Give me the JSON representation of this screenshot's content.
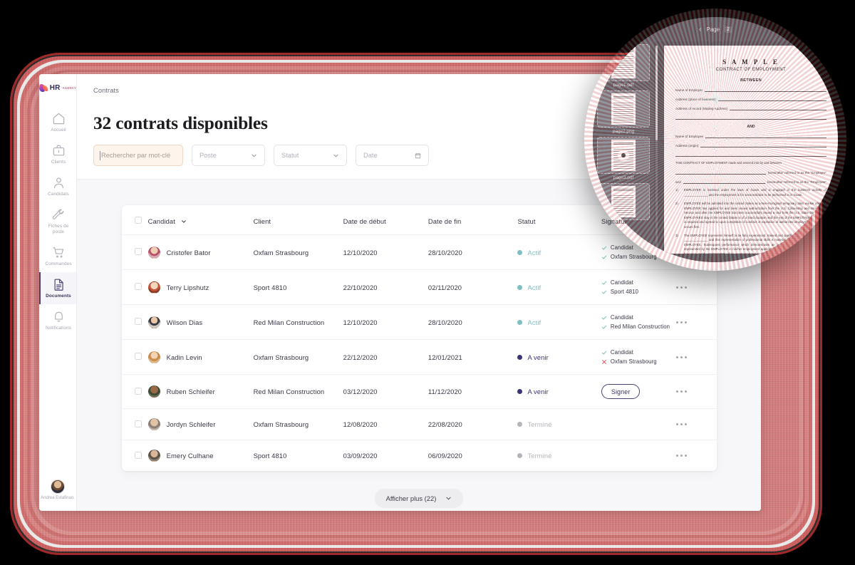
{
  "sidebar": {
    "logo": {
      "mark": "hr-logo-icon",
      "text": "HR",
      "sub": "AGENCY"
    },
    "items": [
      {
        "label": "Accueil",
        "icon": "home-icon"
      },
      {
        "label": "Clients",
        "icon": "briefcase-icon"
      },
      {
        "label": "Candidats",
        "icon": "user-icon"
      },
      {
        "label": "Fiches de poste",
        "icon": "wrench-icon"
      },
      {
        "label": "Commandes",
        "icon": "cart-icon"
      },
      {
        "label": "Documents",
        "icon": "document-icon"
      },
      {
        "label": "Notifications",
        "icon": "bell-icon"
      }
    ],
    "user": {
      "name": "Andrea Estafinao."
    }
  },
  "header": {
    "breadcrumb": "Contrats",
    "title": "32 contrats disponibles"
  },
  "filters": {
    "search_placeholder": "Rechercher par mot-clé",
    "search_value": "",
    "poste_placeholder": "Poste",
    "statut_placeholder": "Statut",
    "date_placeholder": "Date"
  },
  "table": {
    "columns": [
      "Candidat",
      "Client",
      "Date de début",
      "Date de fin",
      "Statut",
      "Signature"
    ],
    "sort_column": "Candidat",
    "rows": [
      {
        "candidate": "Cristofer Bator",
        "client": "Oxfam Strasbourg",
        "start": "12/10/2020",
        "end": "28/10/2020",
        "status": "Actif",
        "status_color": "#7fbfc0",
        "signature": [
          {
            "label": "Candidat",
            "state": "ok"
          },
          {
            "label": "Oxfam Strasbourg",
            "state": "ok"
          }
        ],
        "action": null
      },
      {
        "candidate": "Terry Lipshutz",
        "client": "Sport 4810",
        "start": "22/10/2020",
        "end": "02/11/2020",
        "status": "Actif",
        "status_color": "#7fbfc0",
        "signature": [
          {
            "label": "Candidat",
            "state": "ok"
          },
          {
            "label": "Sport 4810",
            "state": "ok"
          }
        ],
        "action": null
      },
      {
        "candidate": "Wilson Dias",
        "client": "Red Milan Construction",
        "start": "12/10/2020",
        "end": "28/10/2020",
        "status": "Actif",
        "status_color": "#7fbfc0",
        "signature": [
          {
            "label": "Candidat",
            "state": "ok"
          },
          {
            "label": "Red Milan Construction",
            "state": "ok"
          }
        ],
        "action": null
      },
      {
        "candidate": "Kadin Levin",
        "client": "Oxfam Strasbourg",
        "start": "22/12/2020",
        "end": "12/01/2021",
        "status": "A venir",
        "status_color": "#3a3470",
        "signature": [
          {
            "label": "Candidat",
            "state": "ok"
          },
          {
            "label": "Oxfam Strasbourg",
            "state": "ko"
          }
        ],
        "action": null
      },
      {
        "candidate": "Ruben Schleifer",
        "client": "Red Milan Construction",
        "start": "03/12/2020",
        "end": "11/12/2020",
        "status": "A venir",
        "status_color": "#3a3470",
        "signature": [],
        "action": "Signer"
      },
      {
        "candidate": "Jordyn Schleifer",
        "client": "Oxfam Strasbourg",
        "start": "12/08/2020",
        "end": "22/08/2020",
        "status": "Terminé",
        "status_color": "#b6b4bb",
        "signature": [],
        "action": null
      },
      {
        "candidate": "Emery Culhane",
        "client": "Sport 4810",
        "start": "03/09/2020",
        "end": "06/09/2020",
        "status": "Terminé",
        "status_color": "#b6b4bb",
        "signature": [],
        "action": null
      }
    ],
    "show_more": "Afficher plus (22)"
  },
  "viewer": {
    "prev_label": "‹",
    "page_label": "Page",
    "page_number": "2",
    "thumbnails": [
      {
        "name": "page1.pdf",
        "selected": false
      },
      {
        "name": "page2.png",
        "selected": true
      },
      {
        "name": "page3.pdf",
        "selected": false
      }
    ],
    "document": {
      "title": "S A M P L E",
      "subtitle": "CONTRACT OF EMPLOYMENT",
      "between": "BETWEEN",
      "fields_top": [
        "Name of Employer",
        "Address (place of business)",
        "Address of record (Mailing Address)"
      ],
      "and": "AND",
      "fields_bottom": [
        "Name of Employee",
        "Address (origin)"
      ],
      "intro": "THIS CONTRACT OF EMPLOYMENT made and entered into by and between",
      "party1": "hereinafter referred to as the \"Employer\"",
      "party2": "hereinafter referred to as the \"Employee\"",
      "and_word": "and",
      "clauses": [
        {
          "n": "1)",
          "text": "EMPLOYER is licensed under the laws of Guam and is engaged in the business activity of ______________ and the employment is for services/labor to be performed in in Guam."
        },
        {
          "n": "2)",
          "text": "EMPLOYEE will be admitted into the United States as a Non-Immigrant temporary alien worker after the EMPLOYER has applied for and been issued authorization from the U.S. Citizenship and Immigration Service and after the EMPLOYEE has been successfully issued a visa from the U.S. State Department. EMPLOYEES stay in the United States is of a fixed duration and the exit of the EMPLOYEE from Guam is required and agreed to upon completion of contract or expiration of authorized employment, whichever occurs first."
        },
        {
          "n": "3)",
          "text": "The EMPLOYEE represents himself to be fully experienced, trained and qualified to perform duties as a ______________ and this representation of professional skills is material in the decision to accept the EMPLOYEE. Subsequent performance which demonstrates an actual skill below that which was represented by the EMPLOYEE in his/her employment application shall be the basis of the termination for cause and the EMPLOYEE will be repatriated to the place of hire."
        }
      ]
    }
  },
  "colors": {
    "accent": "#4a4273",
    "active_status": "#7fbfc0",
    "upcoming_status": "#3a3470",
    "done_status": "#b6b4bb",
    "check": "#7fbfc0",
    "cross": "#e04a4a",
    "frame": "#cf7a7a"
  }
}
